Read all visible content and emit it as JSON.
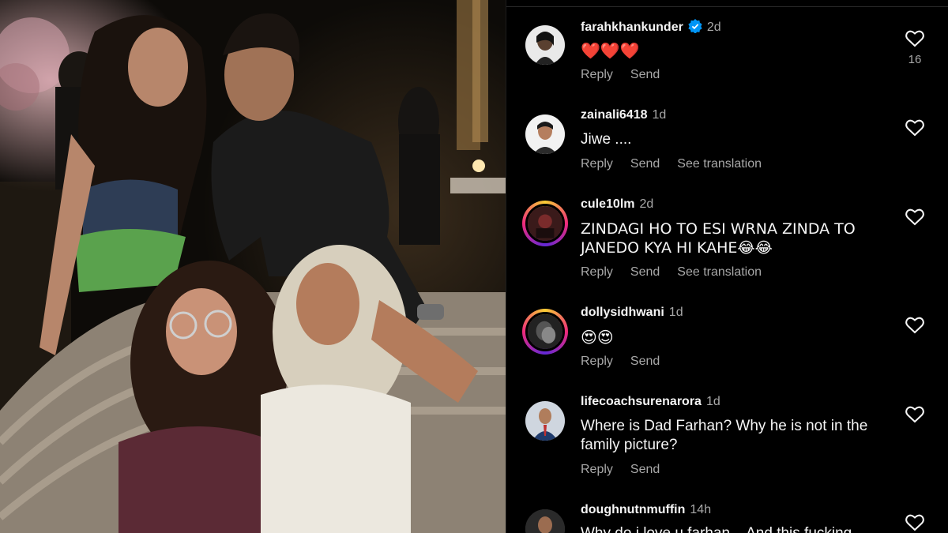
{
  "post": {
    "photo_icon": "group-photo"
  },
  "comments": [
    {
      "username": "farahkhankunder",
      "verified": true,
      "time": "2d",
      "text": "❤️❤️❤️",
      "reply": "Reply",
      "send": "Send",
      "likes": "16",
      "story_ring": false
    },
    {
      "username": "zainali6418",
      "time": "1d",
      "text": "Jiwe ....",
      "reply": "Reply",
      "send": "Send",
      "translation": "See translation",
      "story_ring": false
    },
    {
      "username": "cule10lm",
      "time": "2d",
      "text": "ZINDAGI HO TO ESI WRNA ZINDA TO JANEDO KYA HI KAHE😂😂",
      "reply": "Reply",
      "send": "Send",
      "translation": "See translation",
      "story_ring": true
    },
    {
      "username": "dollysidhwani",
      "time": "1d",
      "text": "😍😍",
      "reply": "Reply",
      "send": "Send",
      "story_ring": true
    },
    {
      "username": "lifecoachsurenarora",
      "time": "1d",
      "text": "Where is Dad Farhan? Why he is not in the family picture?",
      "reply": "Reply",
      "send": "Send",
      "story_ring": false
    },
    {
      "username": "doughnutnmuffin",
      "time": "14h",
      "text": "Why do i love u farhan... And this fucking",
      "story_ring": false
    }
  ],
  "colors": {
    "background": "#000000",
    "primary_text": "#f5f5f5",
    "secondary_text": "#a8a8a8",
    "verified_blue": "#0095f6",
    "heart_red": "#e0245e"
  }
}
